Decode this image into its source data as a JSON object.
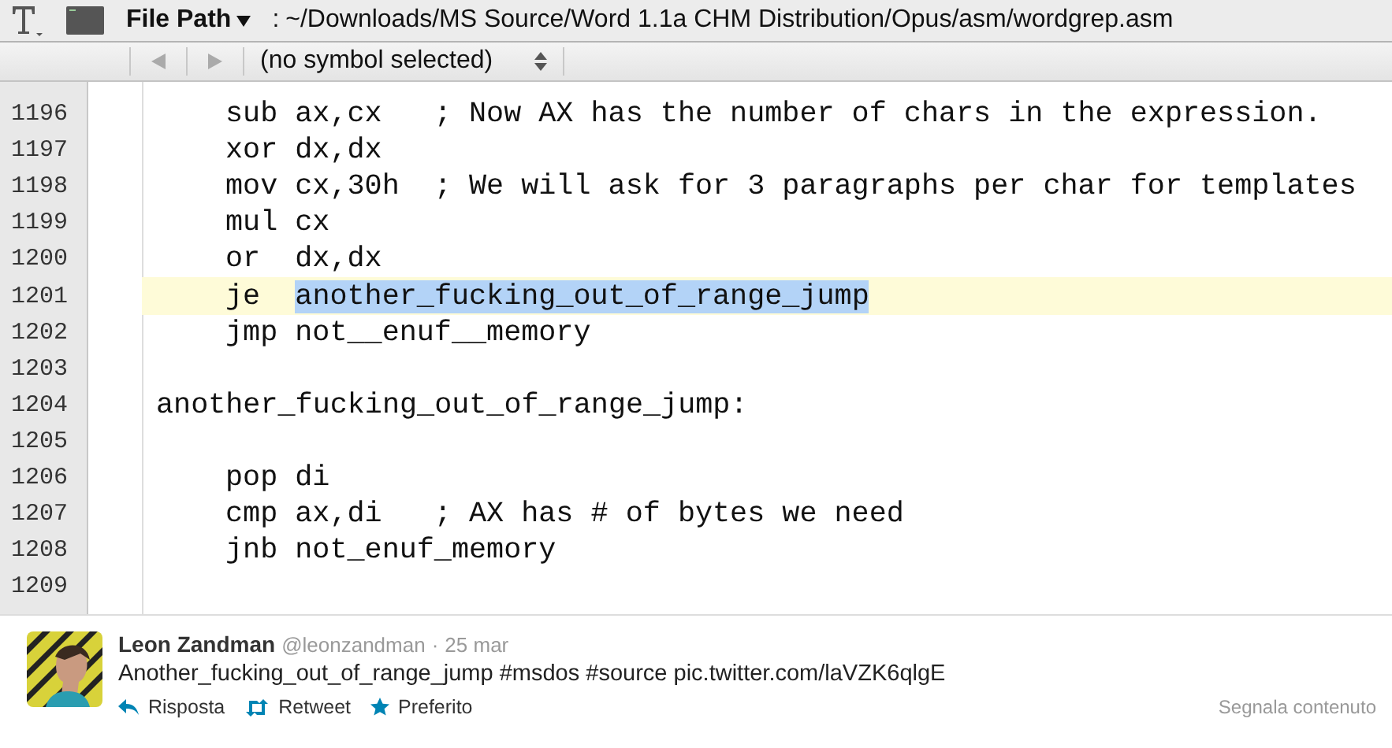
{
  "toolbar": {
    "path_label": "File Path",
    "path_separator": ":",
    "path": "~/Downloads/MS Source/Word 1.1a CHM Distribution/Opus/asm/wordgrep.asm"
  },
  "symbol_bar": {
    "back_disabled": true,
    "forward_disabled": true,
    "symbol": "(no symbol selected)"
  },
  "lines": [
    {
      "number": "1196",
      "kind": "instruction",
      "code": "sub ax,cx   ; Now AX has the number of chars in the expression.",
      "current": false
    },
    {
      "number": "1197",
      "kind": "instruction",
      "code": "xor dx,dx",
      "current": false
    },
    {
      "number": "1198",
      "kind": "instruction",
      "code": "mov cx,30h  ; We will ask for 3 paragraphs per char for templates",
      "current": false
    },
    {
      "number": "1199",
      "kind": "instruction",
      "code": "mul cx",
      "current": false
    },
    {
      "number": "1200",
      "kind": "instruction",
      "code": "or  dx,dx",
      "current": false
    },
    {
      "number": "1201",
      "kind": "instruction",
      "code": "je  ",
      "selection": "another_fucking_out_of_range_jump",
      "current": true
    },
    {
      "number": "1202",
      "kind": "instruction",
      "code": "jmp not__enuf__memory",
      "current": false
    },
    {
      "number": "1203",
      "kind": "blank",
      "current": false
    },
    {
      "number": "1204",
      "kind": "label",
      "code": "another_fucking_out_of_range_jump:",
      "current": false
    },
    {
      "number": "1205",
      "kind": "blank",
      "current": false
    },
    {
      "number": "1206",
      "kind": "instruction",
      "code": "pop di",
      "current": false
    },
    {
      "number": "1207",
      "kind": "instruction",
      "code": "cmp ax,di   ; AX has # of bytes we need",
      "current": false
    },
    {
      "number": "1208",
      "kind": "instruction",
      "code": "jnb not_enuf_memory",
      "current": false
    },
    {
      "number": "1209",
      "kind": "blank",
      "current": false
    }
  ],
  "tweet": {
    "name": "Leon Zandman",
    "handle": "@leonzandman",
    "separator": "·",
    "date": "25 mar",
    "text": "Another_fucking_out_of_range_jump #msdos #source pic.twitter.com/laVZK6qlgE",
    "actions": [
      {
        "kind": "reply",
        "label": "Risposta"
      },
      {
        "kind": "retweet",
        "label": "Retweet"
      },
      {
        "kind": "favorite",
        "label": "Preferito"
      }
    ],
    "report": "Segnala contenuto"
  }
}
